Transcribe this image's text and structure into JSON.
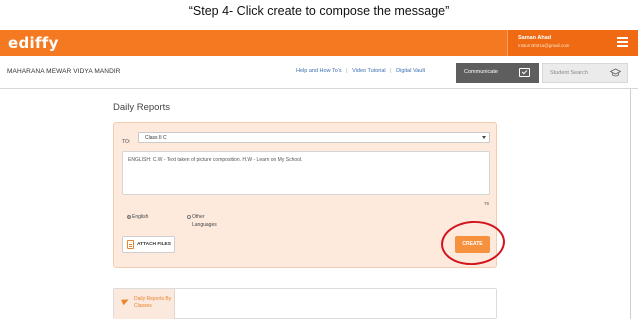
{
  "caption": "“Step 4- Click create to compose the message”",
  "topbar": {
    "logo": "ediffy",
    "user_name": "Saman Ahad",
    "user_email": "msturn3021a@gmail.com"
  },
  "navbar": {
    "school_name": "MAHARANA MEWAR VIDYA MANDIR",
    "links": [
      "Help and How To's",
      "Video Tutorial",
      "Digital Vault"
    ],
    "separator": "|",
    "communicate_label": "Communicate",
    "student_search_placeholder": "Student Search"
  },
  "page": {
    "title": "Daily Reports"
  },
  "form": {
    "to_label": "TO:",
    "to_value": "Class II C",
    "message": "ENGLISH: C.W - Text taken of picture composition.  H.W - Learn on My School.",
    "char_count": "76",
    "language_options": [
      "English",
      "Other Languages"
    ],
    "selected_language": "English",
    "attach_label": "ATTACH FILES",
    "create_label": "CREATE"
  },
  "bottom_nav": {
    "tab_label": "Daily Reports By Classes"
  },
  "colors": {
    "brand_orange": "#f47920",
    "annotation_red": "#d3141d",
    "card_bg": "#fdeadd"
  }
}
